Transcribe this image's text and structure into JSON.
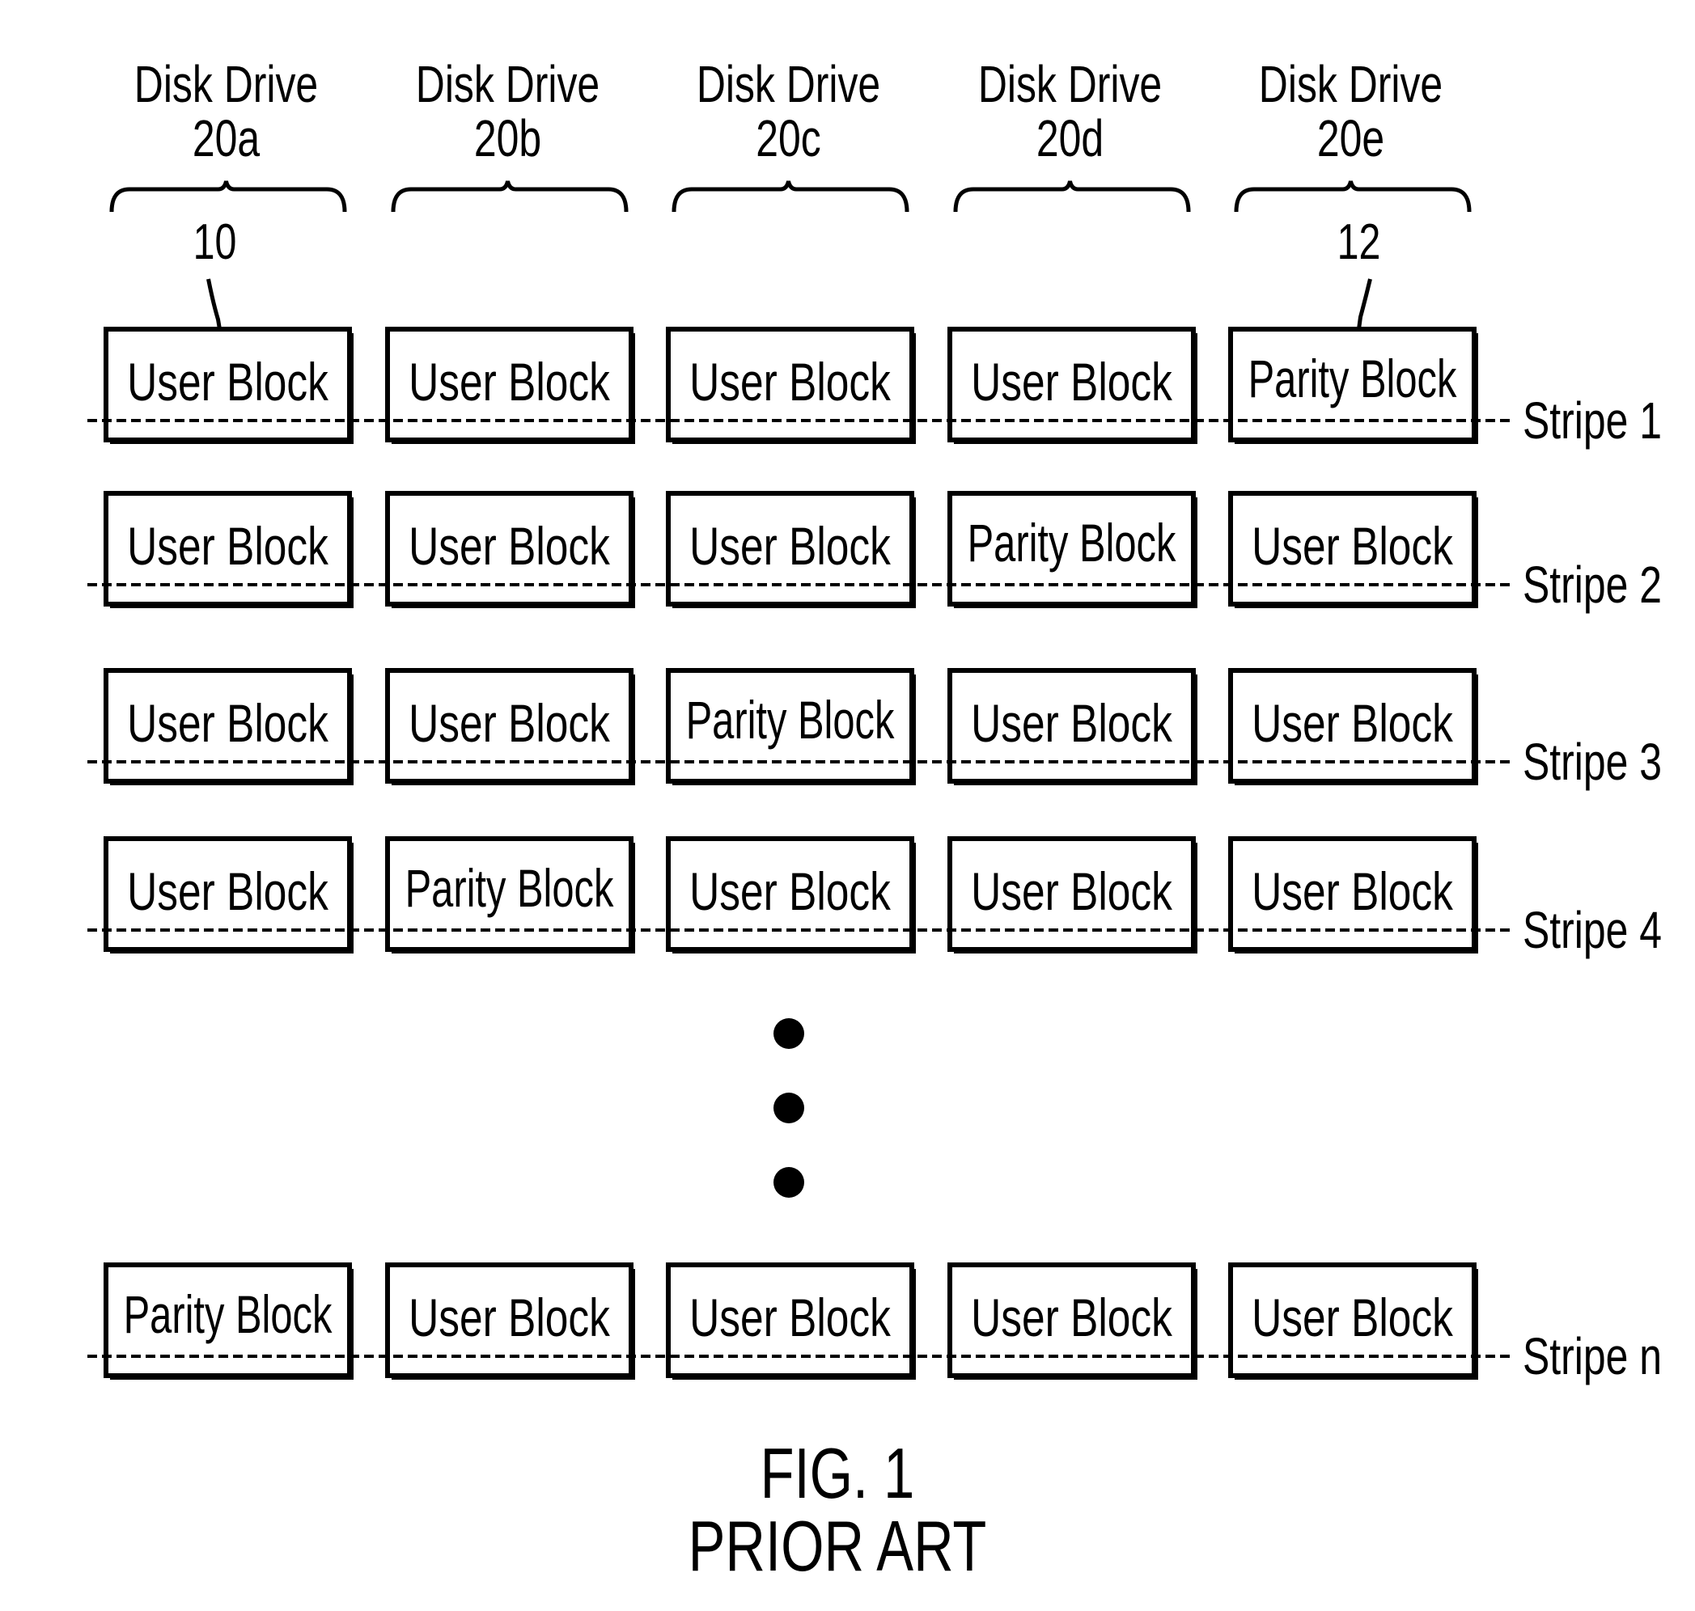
{
  "drives": [
    {
      "label": "Disk Drive",
      "id": "20a"
    },
    {
      "label": "Disk Drive",
      "id": "20b"
    },
    {
      "label": "Disk Drive",
      "id": "20c"
    },
    {
      "label": "Disk Drive",
      "id": "20d"
    },
    {
      "label": "Disk Drive",
      "id": "20e"
    }
  ],
  "reference_numerals": [
    {
      "text": "10",
      "column": 0
    },
    {
      "text": "12",
      "column": 4
    }
  ],
  "stripes": [
    {
      "label": "Stripe 1",
      "blocks": [
        "User Block",
        "User Block",
        "User Block",
        "User Block",
        "Parity Block"
      ]
    },
    {
      "label": "Stripe 2",
      "blocks": [
        "User Block",
        "User Block",
        "User Block",
        "Parity Block",
        "User Block"
      ]
    },
    {
      "label": "Stripe 3",
      "blocks": [
        "User Block",
        "User Block",
        "Parity Block",
        "User Block",
        "User Block"
      ]
    },
    {
      "label": "Stripe 4",
      "blocks": [
        "User Block",
        "Parity Block",
        "User Block",
        "User Block",
        "User Block"
      ]
    },
    {
      "label": "Stripe n",
      "blocks": [
        "Parity Block",
        "User Block",
        "User Block",
        "User Block",
        "User Block"
      ]
    }
  ],
  "ellipsis": "continuation-dots",
  "caption": {
    "figure": "FIG. 1",
    "subtitle": "PRIOR ART"
  }
}
